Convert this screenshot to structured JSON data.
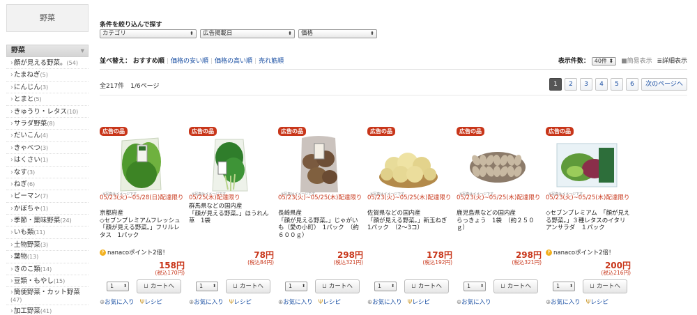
{
  "sidebar": {
    "title": "野菜",
    "category": "野菜",
    "items": [
      {
        "label": "顔が見える野菜。",
        "count": "(54)"
      },
      {
        "label": "たまねぎ",
        "count": "(5)"
      },
      {
        "label": "にんじん",
        "count": "(3)"
      },
      {
        "label": "とまと",
        "count": "(5)"
      },
      {
        "label": "きゅうり・レタス",
        "count": "(10)"
      },
      {
        "label": "サラダ野菜",
        "count": "(8)"
      },
      {
        "label": "だいこん",
        "count": "(4)"
      },
      {
        "label": "きゃべつ",
        "count": "(3)"
      },
      {
        "label": "はくさい",
        "count": "(1)"
      },
      {
        "label": "なす",
        "count": "(3)"
      },
      {
        "label": "ねぎ",
        "count": "(6)"
      },
      {
        "label": "ピーマン",
        "count": "(7)"
      },
      {
        "label": "かぼちゃ",
        "count": "(1)"
      },
      {
        "label": "季節・薬味野菜",
        "count": "(24)"
      },
      {
        "label": "いも類",
        "count": "(11)"
      },
      {
        "label": "土物野菜",
        "count": "(3)"
      },
      {
        "label": "葉物",
        "count": "(13)"
      },
      {
        "label": "きのこ類",
        "count": "(14)"
      },
      {
        "label": "豆類・もやし",
        "count": "(15)"
      },
      {
        "label": "簡便野菜・カット野菜",
        "count": "(47)"
      },
      {
        "label": "加工野菜",
        "count": "(41)"
      }
    ]
  },
  "filter": {
    "title": "条件を絞り込んで探す",
    "selects": [
      "カテゴリ",
      "広告掲載日",
      "価格"
    ]
  },
  "sort": {
    "label": "並べ替え：",
    "current": "おすすめ順",
    "options": [
      "価格の安い順",
      "価格の高い順",
      "売れ筋順"
    ]
  },
  "display": {
    "label": "表示件数：",
    "value": "40件",
    "simple": "■簡易表示",
    "detail": "≣詳細表示"
  },
  "result_count": "全217件　1/6ページ",
  "pager": {
    "pages": [
      "1",
      "2",
      "3",
      "4",
      "5",
      "6"
    ],
    "current": "1",
    "next": "次のページへ"
  },
  "common": {
    "tag": "広告の品",
    "image_note": "※写真はイメージです",
    "qty": "1",
    "cart": "カートへ",
    "fav": "お気に入り",
    "recipe": "レシピ",
    "nanaco": "nanacoポイント2倍！",
    "nanaco_icon": "P"
  },
  "products": [
    {
      "period": "05/23(火)~05/28(日)配達限り",
      "desc": "京都府産\n◇セブンプレミアムフレッシュ　「顔が見える野菜。」フリルレタス　1パック",
      "nanaco": true,
      "price": "158円",
      "tax": "(税込170円)",
      "recipe": true,
      "image": "lettuce"
    },
    {
      "period": "05/25(木)配達限り",
      "desc": "群馬県などの国内産\n「顔が見える野菜。」ほうれん草　1袋",
      "nanaco": false,
      "price": "78円",
      "tax": "(税込84円)",
      "recipe": true,
      "image": "spinach"
    },
    {
      "period": "05/23(火)~05/25(木)配達限り",
      "desc": "長崎県産\n「顔が見える野菜。」じゃがいも（愛の小町）　1パック　（約６００ｇ）",
      "nanaco": false,
      "price": "298円",
      "tax": "(税込321円)",
      "recipe": true,
      "image": "potato"
    },
    {
      "period": "05/23(火)~05/25(木)配達限り",
      "desc": "佐賀県などの国内産\n「顔が見える野菜。」新玉ねぎ　1パック　（2～3コ）",
      "nanaco": false,
      "price": "178円",
      "tax": "(税込192円)",
      "recipe": true,
      "image": "onion"
    },
    {
      "period": "05/23(火)~05/25(木)配達限り",
      "desc": "鹿児島県などの国内産\nらっきょう　1袋　（約２５０ｇ）",
      "nanaco": false,
      "price": "298円",
      "tax": "(税込321円)",
      "recipe": false,
      "image": "rakkyo"
    },
    {
      "period": "05/23(火)~05/25(木)配達限り",
      "desc": "◇セブンプレミアム　「顔が見える野菜。」３種レタスのイタリアンサラダ　１パック",
      "nanaco": true,
      "price": "200円",
      "tax": "(税込216円)",
      "recipe": true,
      "image": "salad"
    }
  ],
  "colors": {
    "accent_red": "#c8361a",
    "link_blue": "#1a4fa3"
  }
}
